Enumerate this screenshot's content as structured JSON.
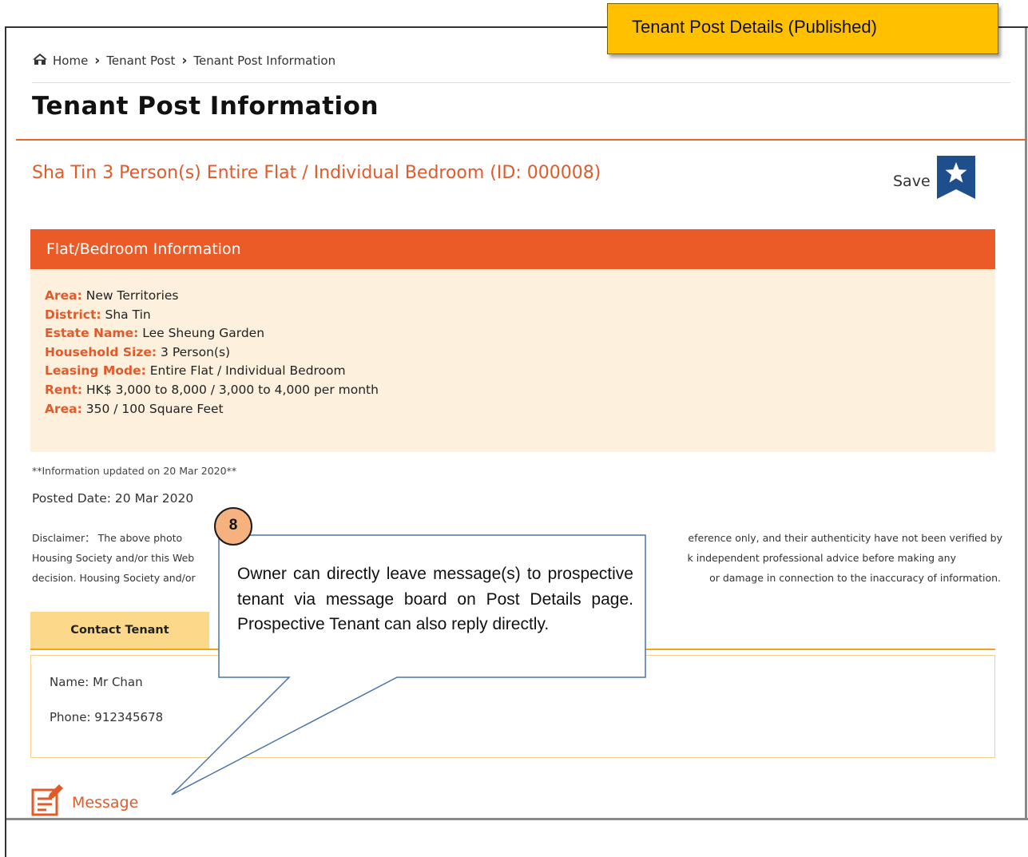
{
  "annotation": {
    "title_tag": "Tenant Post Details (Published)",
    "step_number": "8",
    "callout_text": "Owner can directly leave message(s) to prospective tenant via message board on Post Details page. Prospective Tenant can also reply directly."
  },
  "breadcrumb": {
    "icon": "home-icon",
    "items": [
      "Home",
      "Tenant Post",
      "Tenant Post Information"
    ]
  },
  "page_title": "Tenant Post Information",
  "post": {
    "heading": "Sha Tin 3 Person(s) Entire Flat / Individual Bedroom (ID: 000008)",
    "save_label": "Save",
    "save_icon": "star-bookmark-icon"
  },
  "flat_info": {
    "header": "Flat/Bedroom Information",
    "fields": [
      {
        "label": "Area:",
        "value": "New Territories"
      },
      {
        "label": "District:",
        "value": "Sha Tin"
      },
      {
        "label": "Estate Name:",
        "value": "Lee Sheung Garden"
      },
      {
        "label": "Household Size:",
        "value": "3 Person(s)"
      },
      {
        "label": "Leasing Mode:",
        "value": "Entire Flat / Individual Bedroom"
      },
      {
        "label": "Rent:",
        "value": "HK$ 3,000 to 8,000 / 3,000 to 4,000 per month"
      },
      {
        "label": "Area:",
        "value": "350 / 100 Square Feet"
      }
    ]
  },
  "updated_note": "**Information updated on 20 Mar 2020**",
  "posted_date": "Posted Date: 20 Mar 2020",
  "disclaimer": {
    "line1_left": "Disclaimer： The above photo",
    "line1_right": "eference only, and their authenticity have not been verified by",
    "line2_left": "Housing Society and/or this Web",
    "line2_right": "k independent professional advice before making any",
    "line3_left": "decision. Housing Society and/or",
    "line3_right": "or damage in connection to the inaccuracy of information."
  },
  "contact": {
    "tab_label": "Contact Tenant",
    "name": "Name: Mr Chan",
    "phone": "Phone: 912345678"
  },
  "message": {
    "label": "Message",
    "icon": "message-note-icon"
  },
  "colors": {
    "accent": "#e15a2a",
    "panel_header": "#eb5b27",
    "panel_body": "#fdf0dd",
    "contact_tab": "#fcd98a",
    "title_tag": "#ffc000",
    "save_icon": "#1f4e8c"
  }
}
